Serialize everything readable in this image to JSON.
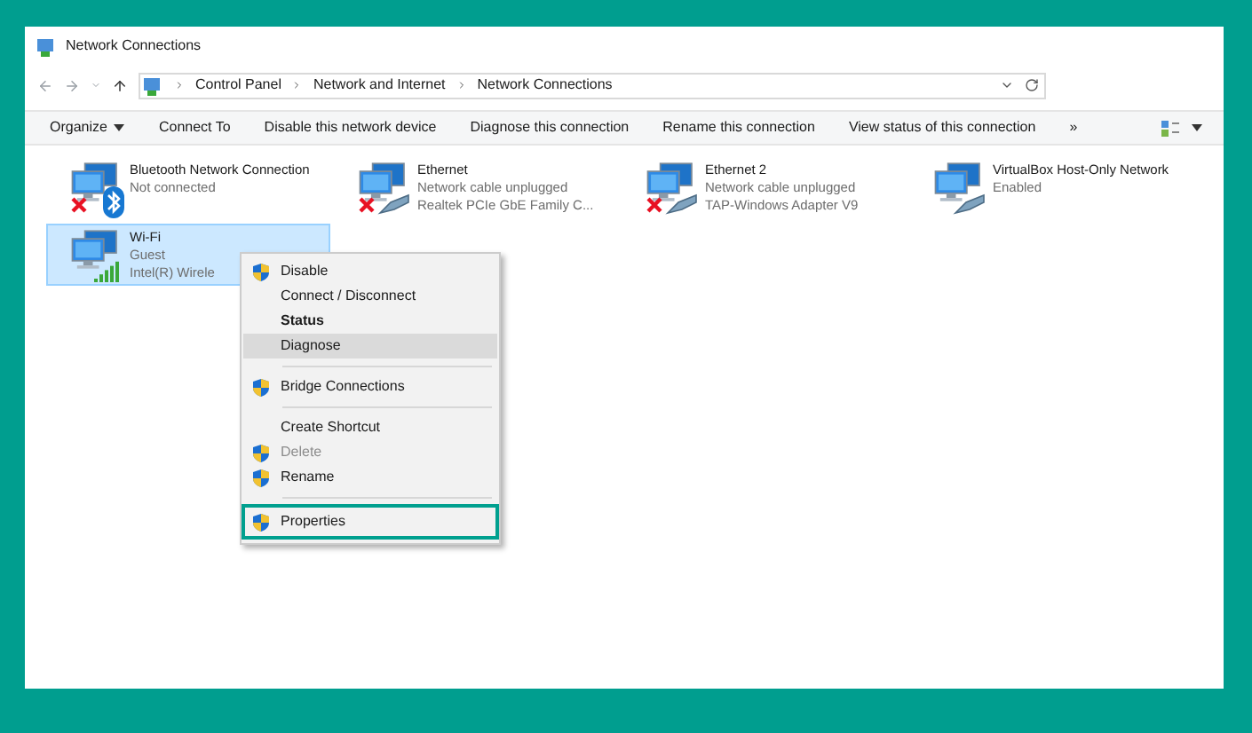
{
  "window": {
    "title": "Network Connections"
  },
  "address_bar": {
    "path": [
      "Control Panel",
      "Network and Internet",
      "Network Connections"
    ]
  },
  "toolbar": {
    "items": [
      {
        "label": "Organize",
        "dropdown": true
      },
      {
        "label": "Connect To",
        "dropdown": false
      },
      {
        "label": "Disable this network device",
        "dropdown": false
      },
      {
        "label": "Diagnose this connection",
        "dropdown": false
      },
      {
        "label": "Rename this connection",
        "dropdown": false
      },
      {
        "label": "View status of this connection",
        "dropdown": false
      }
    ],
    "more": "»"
  },
  "connections": [
    {
      "name": "Bluetooth Network Connection",
      "lines": [
        "Not connected"
      ],
      "kind": "bluetooth",
      "disconnected": true,
      "selected": false
    },
    {
      "name": "Ethernet",
      "lines": [
        "Network cable unplugged",
        "Realtek PCIe GbE Family C..."
      ],
      "kind": "cable",
      "disconnected": true,
      "selected": false
    },
    {
      "name": "Ethernet 2",
      "lines": [
        "Network cable unplugged",
        "TAP-Windows Adapter V9"
      ],
      "kind": "cable",
      "disconnected": true,
      "selected": false
    },
    {
      "name": "VirtualBox Host-Only Network",
      "lines": [
        "Enabled"
      ],
      "kind": "cable",
      "disconnected": false,
      "selected": false
    },
    {
      "name": "Wi-Fi",
      "lines": [
        "Guest",
        "Intel(R) Wirele"
      ],
      "kind": "wifi",
      "disconnected": false,
      "selected": true
    }
  ],
  "context_menu": {
    "items": [
      {
        "kind": "item",
        "label": "Disable",
        "shield": true,
        "bold": false,
        "disabled": false,
        "hovered": false,
        "outlined": false
      },
      {
        "kind": "item",
        "label": "Connect / Disconnect",
        "shield": false,
        "bold": false,
        "disabled": false,
        "hovered": false,
        "outlined": false
      },
      {
        "kind": "item",
        "label": "Status",
        "shield": false,
        "bold": true,
        "disabled": false,
        "hovered": false,
        "outlined": false
      },
      {
        "kind": "item",
        "label": "Diagnose",
        "shield": false,
        "bold": false,
        "disabled": false,
        "hovered": true,
        "outlined": false
      },
      {
        "kind": "separator"
      },
      {
        "kind": "item",
        "label": "Bridge Connections",
        "shield": true,
        "bold": false,
        "disabled": false,
        "hovered": false,
        "outlined": false
      },
      {
        "kind": "separator"
      },
      {
        "kind": "item",
        "label": "Create Shortcut",
        "shield": false,
        "bold": false,
        "disabled": false,
        "hovered": false,
        "outlined": false
      },
      {
        "kind": "item",
        "label": "Delete",
        "shield": true,
        "bold": false,
        "disabled": true,
        "hovered": false,
        "outlined": false
      },
      {
        "kind": "item",
        "label": "Rename",
        "shield": true,
        "bold": false,
        "disabled": false,
        "hovered": false,
        "outlined": false
      },
      {
        "kind": "separator"
      },
      {
        "kind": "item",
        "label": "Properties",
        "shield": true,
        "bold": false,
        "disabled": false,
        "hovered": false,
        "outlined": true
      }
    ]
  }
}
